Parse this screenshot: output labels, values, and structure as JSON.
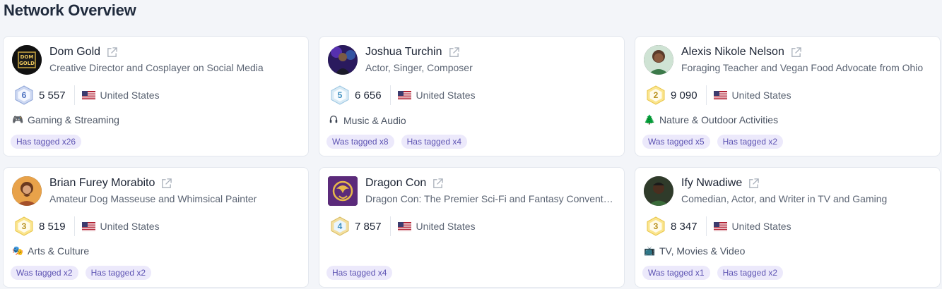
{
  "page": {
    "title": "Network Overview"
  },
  "colors": {
    "tag_bg": "#ece9fb",
    "tag_text": "#5e54b3",
    "card_bg": "#ffffff",
    "page_bg": "#f3f5f9"
  },
  "cards": [
    {
      "name": "Dom Gold",
      "bio": "Creative Director and Cosplayer on Social Media",
      "level": "6",
      "followers": "5 557",
      "country": "United States",
      "category_icon": "game-controller-icon",
      "category": "Gaming & Streaming",
      "tags": [
        "Has tagged x26"
      ]
    },
    {
      "name": "Joshua Turchin",
      "bio": "Actor, Singer, Composer",
      "level": "5",
      "followers": "6 656",
      "country": "United States",
      "category_icon": "headphones-icon",
      "category": "Music & Audio",
      "tags": [
        "Was tagged x8",
        "Has tagged x4"
      ]
    },
    {
      "name": "Alexis Nikole Nelson",
      "bio": "Foraging Teacher and Vegan Food Advocate from Ohio",
      "level": "2",
      "followers": "9 090",
      "country": "United States",
      "category_icon": "tree-icon",
      "category": "Nature & Outdoor Activities",
      "tags": [
        "Was tagged x5",
        "Has tagged x2"
      ]
    },
    {
      "name": "Brian Furey Morabito",
      "bio": "Amateur Dog Masseuse and Whimsical Painter",
      "level": "3",
      "followers": "8 519",
      "country": "United States",
      "category_icon": "theater-masks-icon",
      "category": "Arts & Culture",
      "tags": [
        "Was tagged x2",
        "Has tagged x2"
      ]
    },
    {
      "name": "Dragon Con",
      "bio": "Dragon Con: The Premier Sci-Fi and Fantasy Convention",
      "level": "4",
      "followers": "7 857",
      "country": "United States",
      "category_icon": "",
      "category": "",
      "tags": [
        "Has tagged x4"
      ]
    },
    {
      "name": "Ify Nwadiwe",
      "bio": "Comedian, Actor, and Writer in TV and Gaming",
      "level": "3",
      "followers": "8 347",
      "country": "United States",
      "category_icon": "television-icon",
      "category": "TV, Movies & Video",
      "tags": [
        "Was tagged x1",
        "Has tagged x2"
      ]
    }
  ]
}
